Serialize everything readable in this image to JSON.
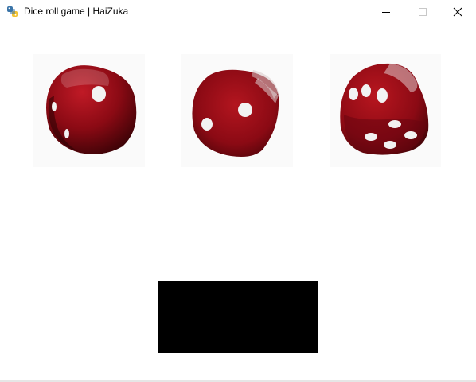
{
  "window": {
    "title": "Dice roll game | HaiZuka",
    "app_icon": "python-icon",
    "controls": {
      "minimize_icon": "minimize-icon",
      "maximize_icon": "maximize-icon",
      "close_icon": "close-icon"
    }
  },
  "dice": [
    {
      "value": 1,
      "color": "#8b0a14"
    },
    {
      "value": 2,
      "color": "#8b0a14"
    },
    {
      "value": 6,
      "color": "#8b0a14"
    }
  ],
  "colors": {
    "die_red": "#8b0a14",
    "pip": "#f2f2f2",
    "panel": "#000000"
  }
}
